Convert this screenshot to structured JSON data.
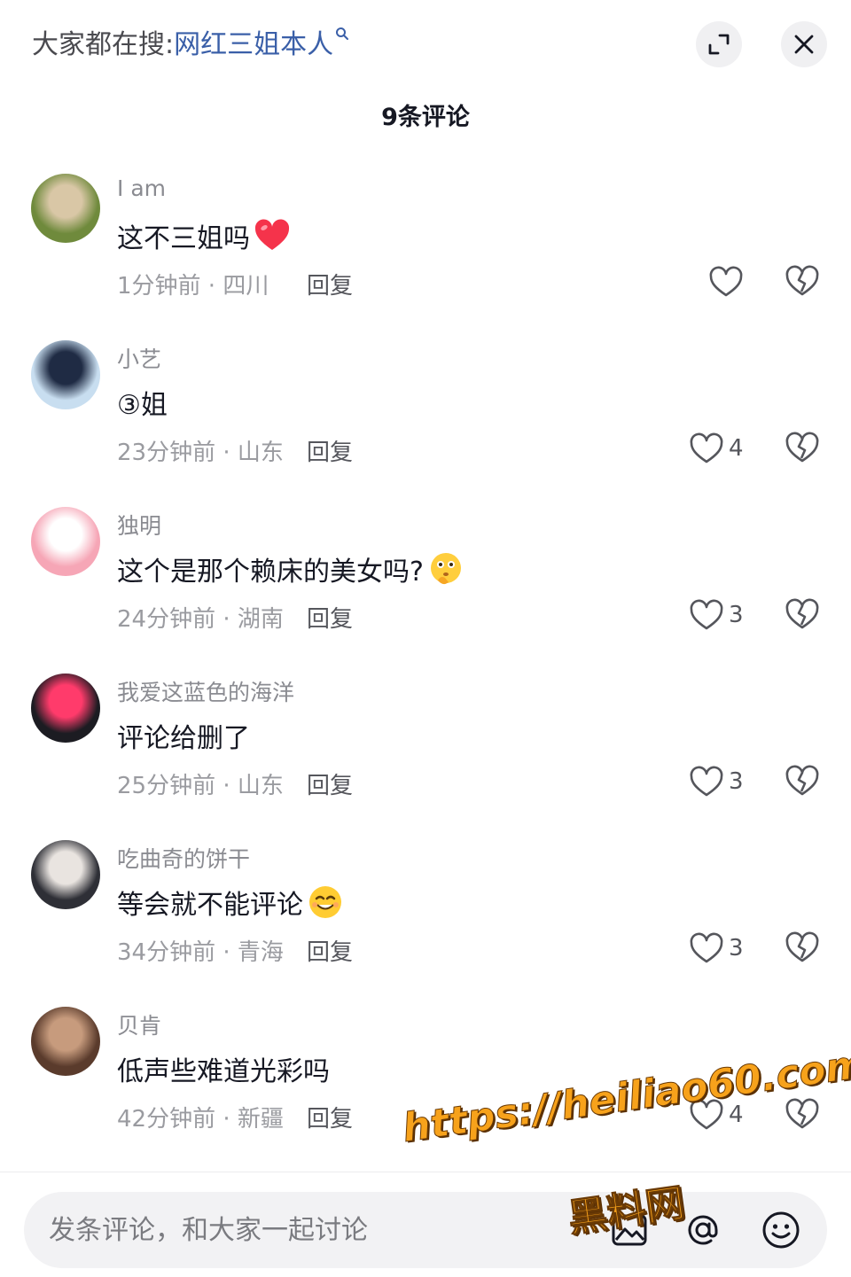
{
  "header": {
    "search_prefix": "大家都在搜:",
    "search_term": "网红三姐本人",
    "expand_icon": "expand-icon",
    "close_icon": "close-icon"
  },
  "comment_count_label": "9条评论",
  "comments": [
    {
      "user": "I am",
      "text": "这不三姐吗",
      "emoji": "red-heart",
      "meta": "1分钟前 · 四川",
      "reply": "回复",
      "likes": "",
      "avatar_colors": [
        "#6f8a3c",
        "#d9c7a6"
      ]
    },
    {
      "user": "小艺",
      "text": "③姐",
      "emoji": "",
      "meta": "23分钟前 · 山东",
      "reply": "回复",
      "likes": "4",
      "avatar_colors": [
        "#c8def0",
        "#1f2b44"
      ]
    },
    {
      "user": "独明",
      "text": "这个是那个赖床的美女吗?",
      "emoji": "thinking-face",
      "meta": "24分钟前 · 湖南",
      "reply": "回复",
      "likes": "3",
      "avatar_colors": [
        "#f6a6b6",
        "#ffffff"
      ]
    },
    {
      "user": "我爱这蓝色的海洋",
      "text": "评论给删了",
      "emoji": "",
      "meta": "25分钟前 · 山东",
      "reply": "回复",
      "likes": "3",
      "avatar_colors": [
        "#1c1c22",
        "#ff3b6b"
      ]
    },
    {
      "user": "吃曲奇的饼干",
      "text": "等会就不能评论",
      "emoji": "smiling-face",
      "meta": "34分钟前 · 青海",
      "reply": "回复",
      "likes": "3",
      "avatar_colors": [
        "#2e2f36",
        "#e9e4e0"
      ]
    },
    {
      "user": "贝肯",
      "text": "低声些难道光彩吗",
      "emoji": "",
      "meta": "42分钟前 · 新疆",
      "reply": "回复",
      "likes": "4",
      "avatar_colors": [
        "#5a3b2c",
        "#c79b7d"
      ]
    }
  ],
  "input": {
    "placeholder": "发条评论，和大家一起讨论",
    "image_icon": "image-icon",
    "mention_icon": "at-icon",
    "emoji_icon": "emoji-icon"
  },
  "watermark": {
    "url": "https://heiliao60.com",
    "brand": "黑料网"
  },
  "colors": {
    "accent_link": "#3a5fa8",
    "text_primary": "#161823",
    "text_secondary": "#8a8b91",
    "watermark": "#f7a21b"
  }
}
